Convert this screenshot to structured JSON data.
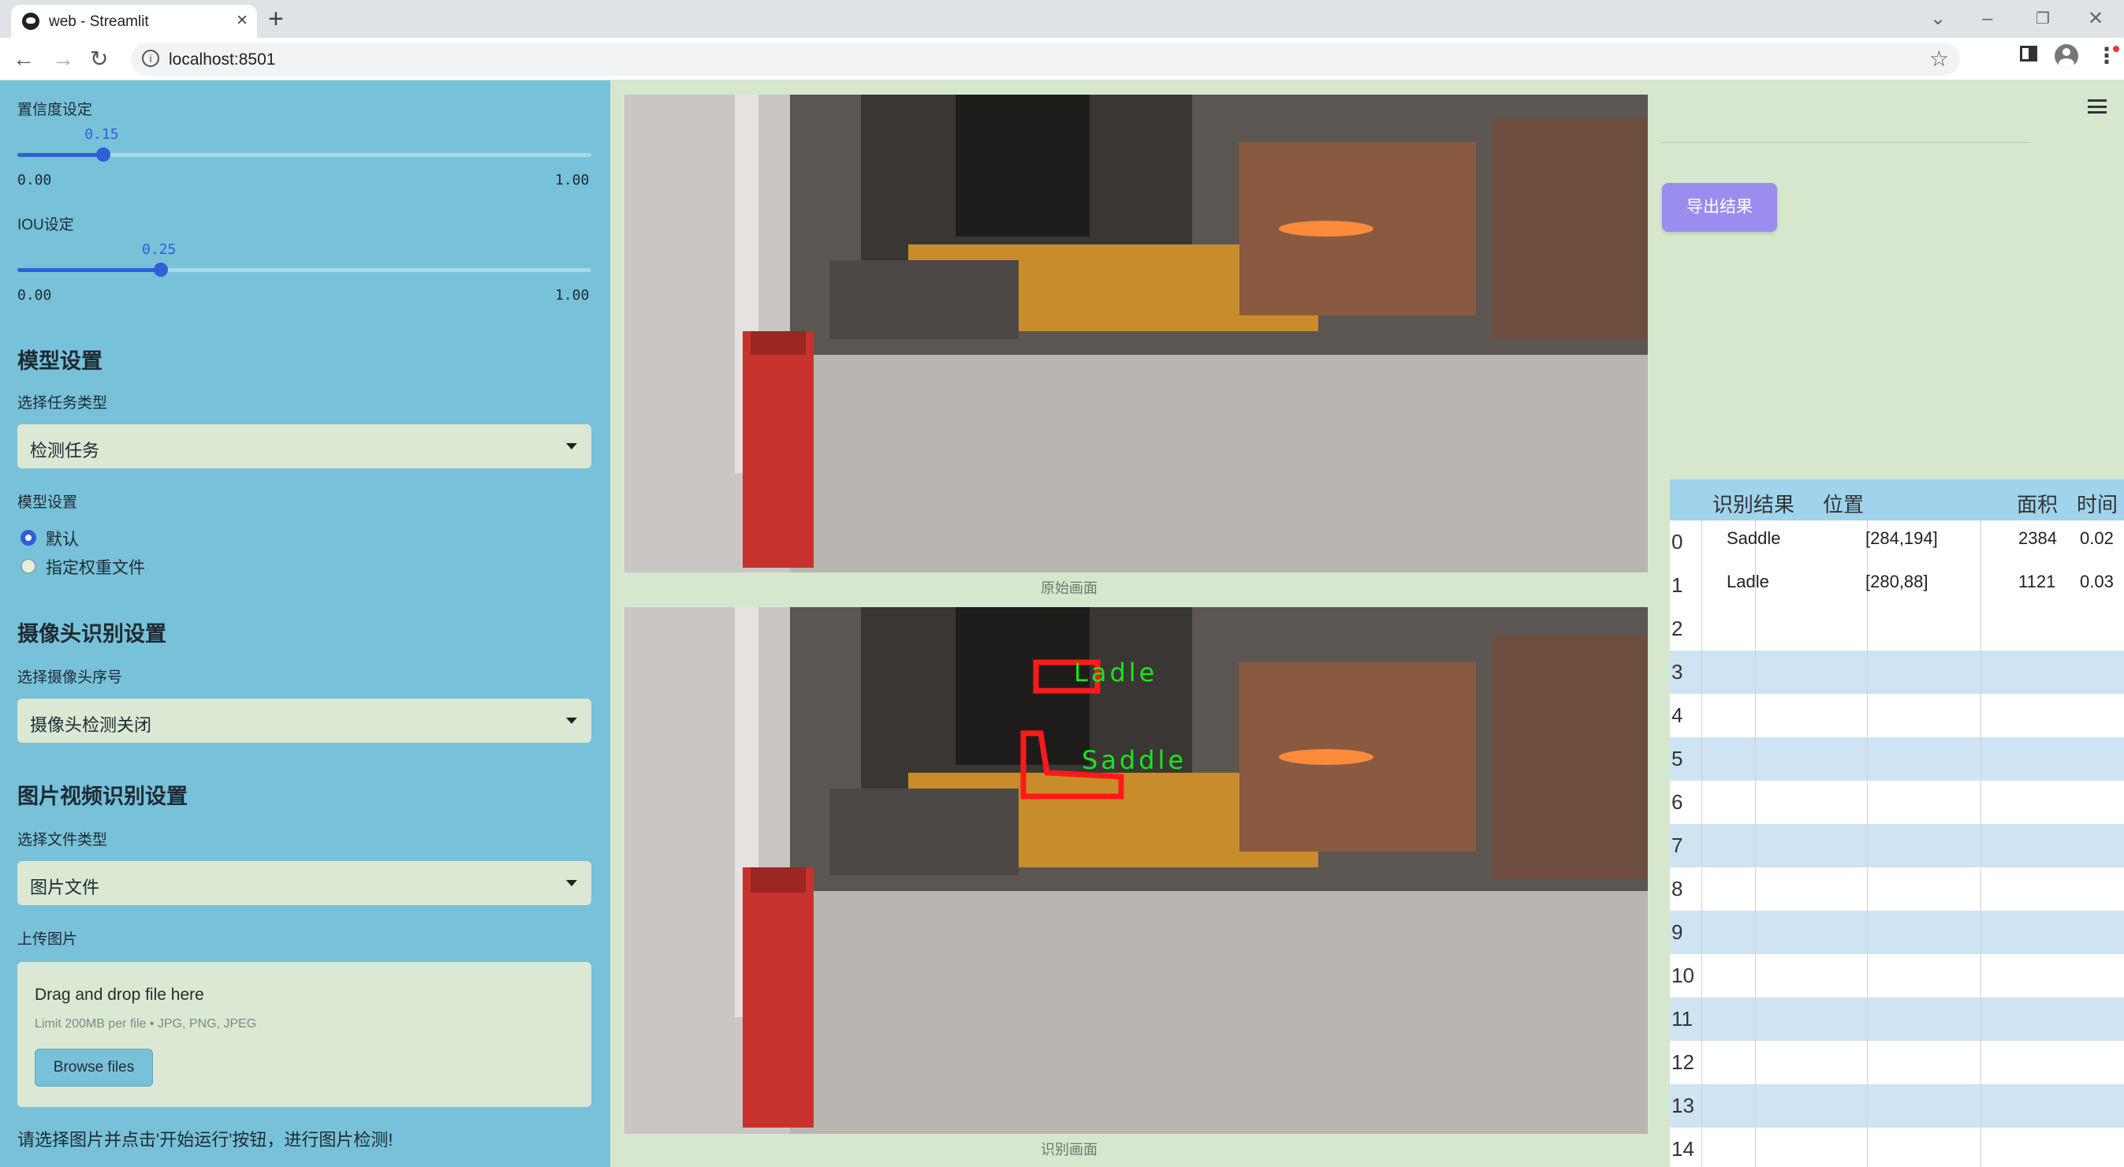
{
  "browser": {
    "tab_title": "web - Streamlit",
    "url": "localhost:8501"
  },
  "sidebar": {
    "confidence": {
      "label": "置信度设定",
      "value": "0.15",
      "fraction": 0.15,
      "min": "0.00",
      "max": "1.00"
    },
    "iou": {
      "label": "IOU设定",
      "value": "0.25",
      "fraction": 0.25,
      "min": "0.00",
      "max": "1.00"
    },
    "model_heading": "模型设置",
    "task_label": "选择任务类型",
    "task_value": "检测任务",
    "model_label": "模型设置",
    "model_options": [
      "默认",
      "指定权重文件"
    ],
    "model_selected": 0,
    "camera_heading": "摄像头识别设置",
    "camera_label": "选择摄像头序号",
    "camera_value": "摄像头检测关闭",
    "media_heading": "图片视频识别设置",
    "filetype_label": "选择文件类型",
    "filetype_value": "图片文件",
    "upload_label": "上传图片",
    "upload_title": "Drag and drop file here",
    "upload_limit": "Limit 200MB per file • JPG, PNG, JPEG",
    "browse_label": "Browse files",
    "footer": "请选择图片并点击'开始运行'按钮，进行图片检测!"
  },
  "main": {
    "caption_original": "原始画面",
    "caption_detected": "识别画面",
    "detections_overlay": [
      "Ladle",
      "Saddle"
    ]
  },
  "right": {
    "export_label": "导出结果",
    "table": {
      "headers": [
        "识别结果",
        "位置",
        "面积",
        "时间"
      ],
      "rows": [
        {
          "idx": "0",
          "cls": "Saddle",
          "pos": "[284,194]",
          "area": "2384",
          "time": "0.02"
        },
        {
          "idx": "1",
          "cls": "Ladle",
          "pos": "[280,88]",
          "area": "1121",
          "time": "0.03"
        },
        {
          "idx": "2"
        },
        {
          "idx": "3"
        },
        {
          "idx": "4"
        },
        {
          "idx": "5"
        },
        {
          "idx": "6"
        },
        {
          "idx": "7"
        },
        {
          "idx": "8"
        },
        {
          "idx": "9"
        },
        {
          "idx": "10"
        },
        {
          "idx": "11"
        },
        {
          "idx": "12"
        },
        {
          "idx": "13"
        },
        {
          "idx": "14"
        }
      ]
    }
  },
  "colors": {
    "sidebar_bg": "#77c2d9",
    "main_bg": "#d6e7cd",
    "accent": "#2f5fd8",
    "export_button": "#9b8cf0",
    "table_header": "#9fd4ec",
    "detection_box": "#ff1a1a",
    "detection_label": "#19e619"
  }
}
